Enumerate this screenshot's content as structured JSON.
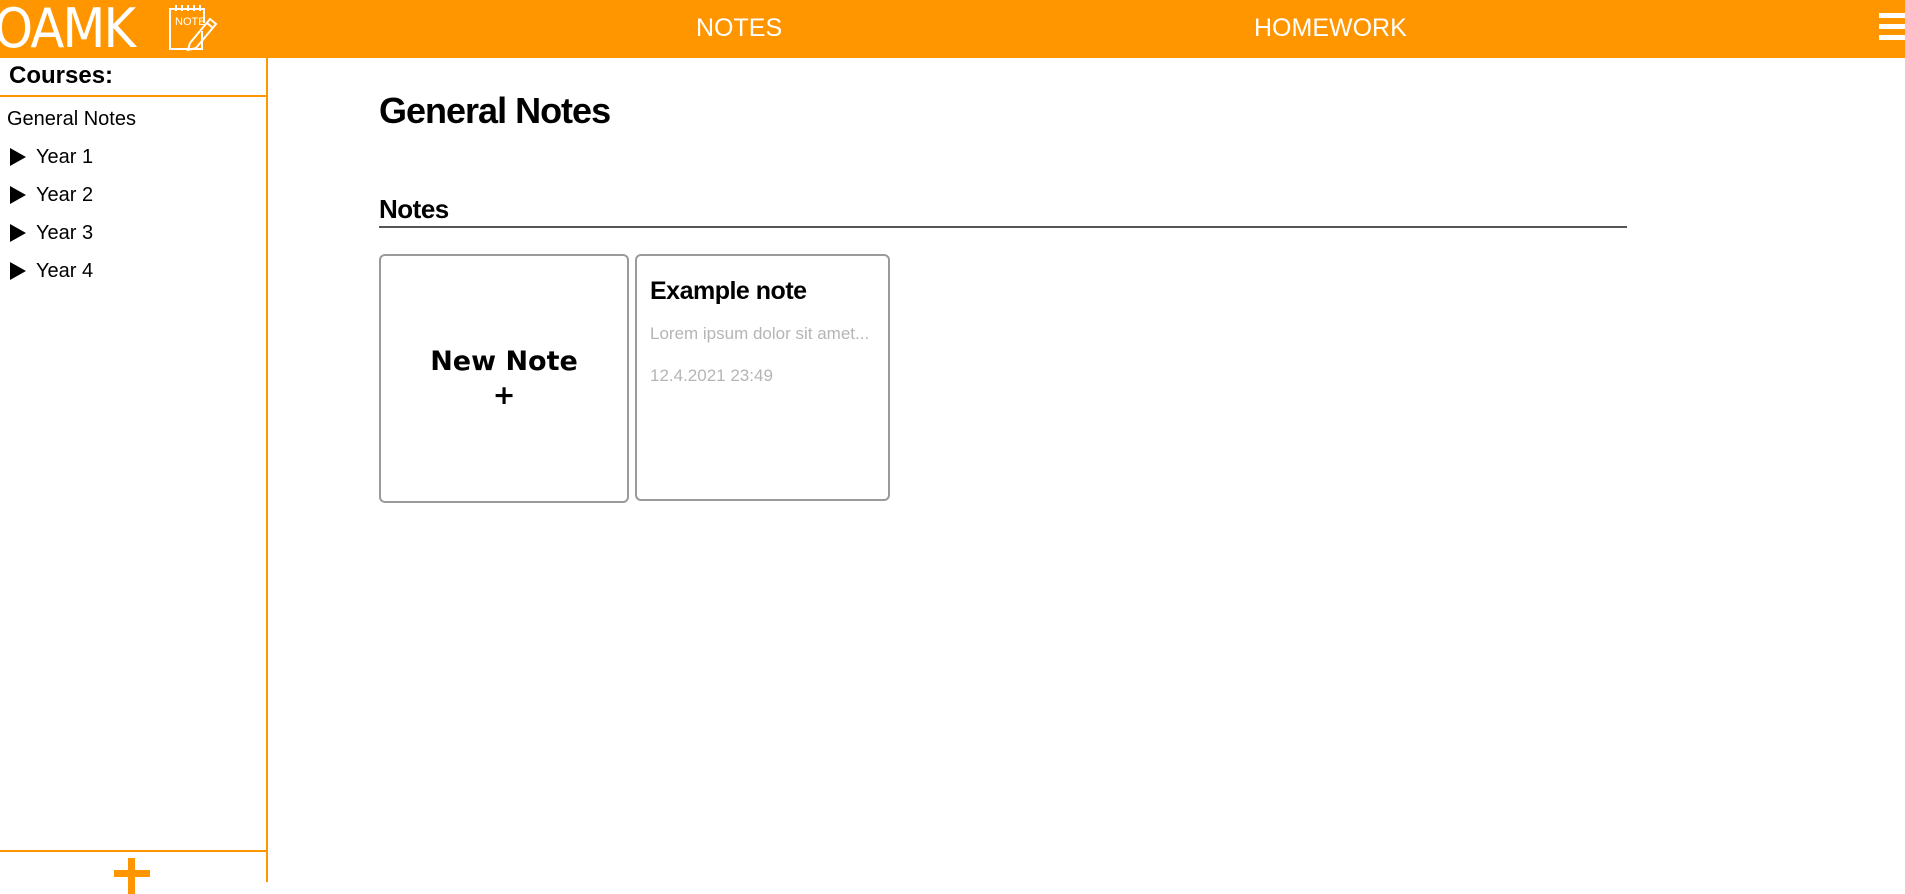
{
  "header": {
    "logo_text": "OAMK",
    "logo_badge": "NOTE",
    "nav": {
      "notes": "NOTES",
      "homework": "HOMEWORK"
    },
    "menu_icon": "hamburger-menu-icon",
    "accent_color": "#ff9600"
  },
  "sidebar": {
    "title": "Courses:",
    "general": "General Notes",
    "years": [
      {
        "label": "Year 1"
      },
      {
        "label": "Year 2"
      },
      {
        "label": "Year 3"
      },
      {
        "label": "Year 4"
      }
    ],
    "add_icon": "plus-icon"
  },
  "main": {
    "title": "General Notes",
    "section_title": "Notes",
    "new_note": {
      "label": "New Note",
      "plus": "+"
    },
    "notes": [
      {
        "title": "Example note",
        "preview": "Lorem ipsum dolor sit amet...",
        "date": "12.4.2021 23:49"
      }
    ]
  }
}
